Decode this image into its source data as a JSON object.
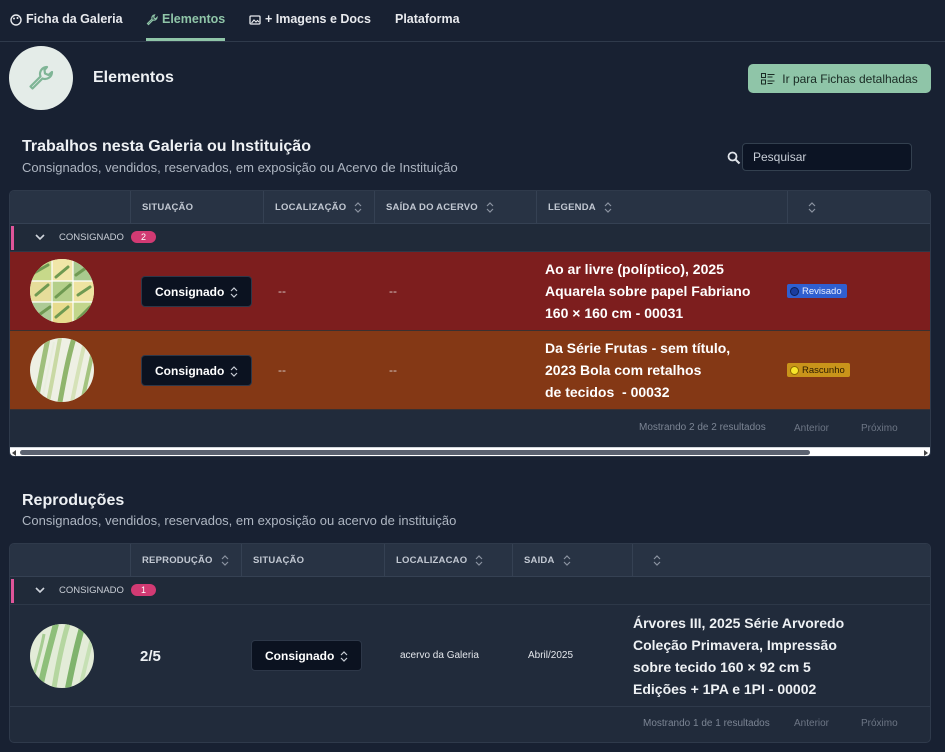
{
  "tabs": [
    {
      "label": "Ficha da Galeria",
      "icon": "palette-icon"
    },
    {
      "label": "Elementos",
      "icon": "wrench-icon",
      "active": true
    },
    {
      "label": "+ Imagens e Docs",
      "icon": "image-icon"
    },
    {
      "label": "Plataforma",
      "icon": ""
    }
  ],
  "header": {
    "title": "Elementos",
    "icon": "wrench-icon",
    "fichas_button": "Ir para Fichas detalhadas"
  },
  "trabalhos": {
    "title": "Trabalhos nesta Galeria ou Instituição",
    "subtitle": "Consignados, vendidos, reservados, em exposição ou Acervo de Instituição",
    "search_placeholder": "Pesquisar",
    "columns": [
      "SITUAÇÃO",
      "LOCALIZAÇÃO",
      "SAÍDA DO ACERVO",
      "LEGENDA"
    ],
    "group": {
      "label": "CONSIGNADO",
      "count": "2"
    },
    "rows": [
      {
        "situacao": "Consignado",
        "localizacao": "--",
        "saida": "--",
        "legenda": [
          "Ao ar livre (políptico), 2025",
          "Aquarela sobre papel Fabriano",
          "160 × 160 cm - 00031"
        ],
        "status": "Revisado",
        "status_color": "#2f5fd0",
        "row_color": "#7d1e1e"
      },
      {
        "situacao": "Consignado",
        "localizacao": "--",
        "saida": "--",
        "legenda": [
          "Da Série Frutas - sem título,",
          "2023 Bola com retalhos",
          "de tecidos  - 00032"
        ],
        "status": "Rascunho",
        "status_color": "#e2b31c",
        "row_color": "#843815"
      }
    ],
    "pager": {
      "info": "Mostrando 2 de 2 resultados",
      "prev": "Anterior",
      "next": "Próximo"
    }
  },
  "reproducoes": {
    "title": "Reproduções",
    "subtitle": "Consignados, vendidos, reservados, em exposição ou acervo de instituição",
    "columns": [
      "REPRODUÇÃO",
      "SITUAÇÃO",
      "LOCALIZACAO",
      "SAIDA"
    ],
    "group": {
      "label": "CONSIGNADO",
      "count": "1"
    },
    "rows": [
      {
        "reproducao": "2/5",
        "situacao": "Consignado",
        "localizacao": "acervo da Galeria",
        "saida": "Abril/2025",
        "legenda": [
          "Árvores III, 2025 Série Arvoredo",
          "Coleção Primavera, Impressão",
          "sobre tecido 160 × 92 cm 5",
          "Edições + 1PA e 1PI - 00002"
        ]
      }
    ],
    "pager": {
      "info": "Mostrando 1 de 1 resultados",
      "prev": "Anterior",
      "next": "Próximo"
    }
  }
}
